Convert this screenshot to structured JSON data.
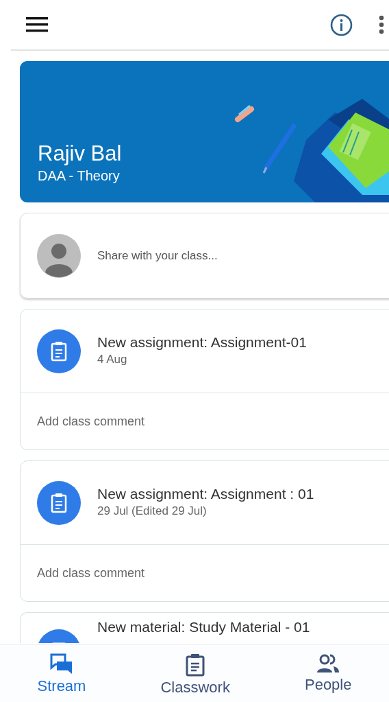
{
  "class_banner": {
    "title": "Rajiv Bal",
    "subtitle": "DAA -  Theory"
  },
  "share": {
    "placeholder": "Share with your class..."
  },
  "posts": [
    {
      "kind": "assignment",
      "title": "New assignment: Assignment-01",
      "date": "4 Aug",
      "comment_placeholder": "Add class comment"
    },
    {
      "kind": "assignment",
      "title": "New assignment: Assignment : 01",
      "date": "29 Jul (Edited 29 Jul)",
      "comment_placeholder": "Add class comment"
    },
    {
      "kind": "material",
      "title": "New material: Study Material - 01"
    }
  ],
  "bottom_nav": [
    {
      "kind": "stream",
      "label": "Stream",
      "selected": true
    },
    {
      "kind": "classwork",
      "label": "Classwork",
      "selected": false
    },
    {
      "kind": "people",
      "label": "People",
      "selected": false
    }
  ]
}
